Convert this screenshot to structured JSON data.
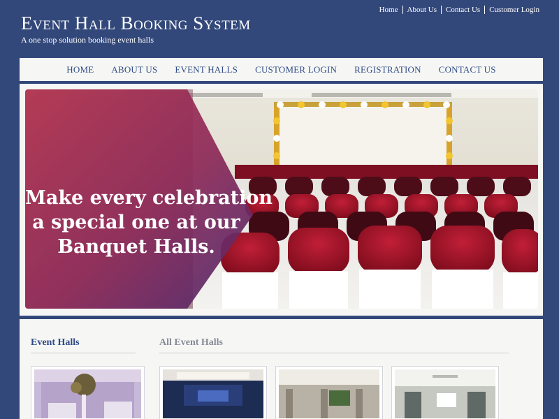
{
  "header": {
    "title": "Event Hall Booking System",
    "tagline": "A one stop solution booking event halls",
    "top_links": [
      "Home",
      "About Us",
      "Contact Us",
      "Customer Login"
    ]
  },
  "nav": {
    "items": [
      "HOME",
      "ABOUT US",
      "EVENT HALLS",
      "CUSTOMER LOGIN",
      "REGISTRATION",
      "CONTACT US"
    ]
  },
  "banner": {
    "headline_lines": [
      "Make every celebration",
      "a special one at our",
      "Banquet Halls."
    ]
  },
  "content": {
    "side_heading": "Event Halls",
    "main_heading": "All Event Halls"
  },
  "colors": {
    "page_background": "#33487a",
    "nav_text": "#2f4b86",
    "banner_overlay": "#b8324a",
    "chair_red": "#9c1225"
  }
}
